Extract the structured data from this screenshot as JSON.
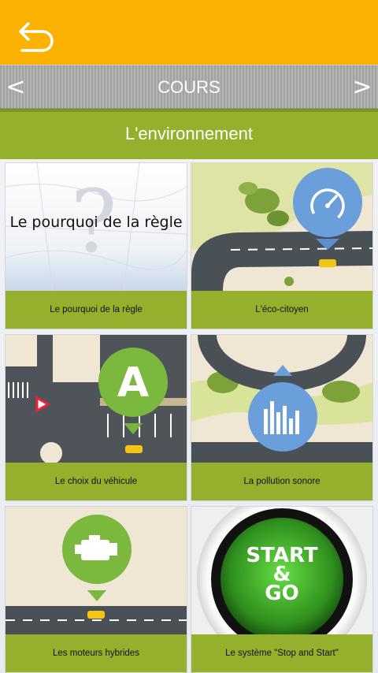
{
  "header": {
    "back_icon": "back-arrow-icon",
    "background_color": "#fbb203"
  },
  "nav": {
    "prev": "<",
    "title": "COURS",
    "next": ">"
  },
  "section": {
    "title": "L'environnement",
    "color": "#95b02c"
  },
  "tiles": [
    {
      "label": "Le pourquoi de la règle",
      "image_text": "Le pourquoi de la règle",
      "icon": "question-map-icon"
    },
    {
      "label": "L'éco-citoyen",
      "icon": "speedometer-icon"
    },
    {
      "label": "Le choix du véhicule",
      "image_text": "A",
      "icon": "energy-label-a-icon"
    },
    {
      "label": "La pollution sonore",
      "icon": "sound-level-icon"
    },
    {
      "label": "Les moteurs hybrides",
      "icon": "engine-icon"
    },
    {
      "label": "Le système \"Stop and Start\"",
      "image_text": [
        "START",
        "&",
        "GO"
      ],
      "icon": "start-go-button-icon"
    }
  ]
}
